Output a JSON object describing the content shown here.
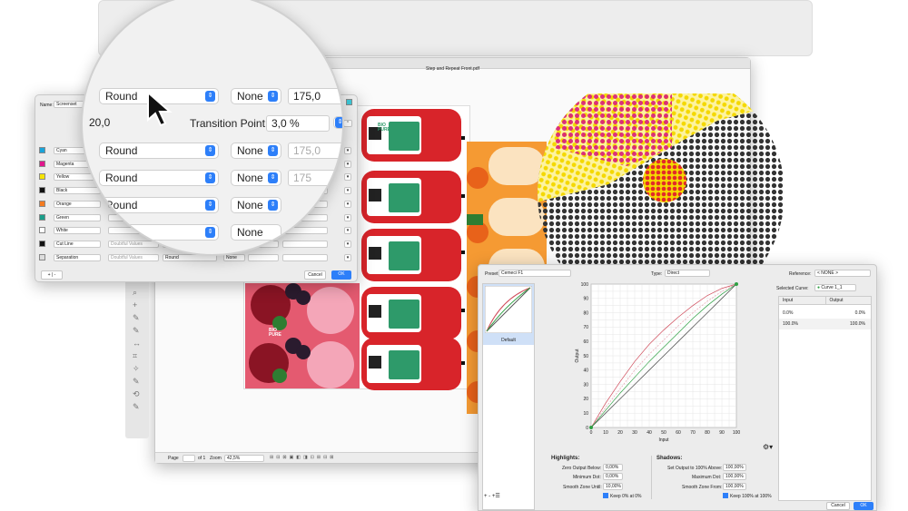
{
  "doc_window": {
    "title": "Step and Repeat Front.pdf"
  },
  "ink_dialog": {
    "name_label": "Name:",
    "name_value": "Screenset",
    "rows": [
      {
        "swatch": "#1aa3d9",
        "name": "Cyan",
        "shape": "Round",
        "dot": "None"
      },
      {
        "swatch": "#e0168c",
        "name": "Magenta",
        "shape": "Round",
        "dot": "None"
      },
      {
        "swatch": "#f6e400",
        "name": "Yellow",
        "shape": "Round",
        "dot": "None"
      },
      {
        "swatch": "#111111",
        "name": "Black",
        "shape": "Round",
        "dot": "None"
      },
      {
        "swatch": "#f47b20",
        "name": "Orange",
        "shape": "Round",
        "dot": "None"
      },
      {
        "swatch": "#1a9e8a",
        "name": "Green",
        "shape": "Round",
        "dot": "None"
      },
      {
        "swatch": "#ffffff",
        "name": "White",
        "shape": "Round",
        "dot": "None"
      },
      {
        "swatch": "#111111",
        "name": "Cut Line",
        "placeholder": "Doubtful Values",
        "shape": "Round",
        "dot": "None"
      },
      {
        "swatch": "#dddddd",
        "name": "Separation",
        "placeholder": "Doubtful Values",
        "shape": "Round",
        "dot": "None"
      }
    ],
    "cancel": "Cancel",
    "ok": "OK",
    "add_remove": "+ | -"
  },
  "magnifier": {
    "row1": {
      "shape": "Round",
      "dot": "None",
      "value": "175,0"
    },
    "row2": {
      "left_value": "20,0",
      "transition_label": "Transition Point:",
      "transition_value": "3,0 %"
    },
    "row3": {
      "shape": "Round",
      "dot": "None",
      "value": "175,0"
    },
    "row4": {
      "shape": "Round",
      "dot": "None",
      "value": "175"
    },
    "row5": {
      "shape": "Round",
      "dot": "None"
    },
    "row6": {
      "dot": "None"
    }
  },
  "status_bar": {
    "page_label": "Page",
    "page_of": "of 1",
    "zoom_label": "Zoom",
    "zoom_value": "42,5%"
  },
  "labels": {
    "brand": "BIO PURE"
  },
  "curve_dialog": {
    "preset_label": "Preset:",
    "preset_value": "Cemeci F1",
    "type_label": "Type:",
    "type_value": "Direct",
    "reference_label": "Reference:",
    "reference_value": "< NONE >",
    "selected_curve_label": "Selected Curve:",
    "selected_curve_value": "Curve 1_1",
    "thumb_label": "Default",
    "y_axis_label": "Output",
    "x_axis_label": "Input",
    "ticks": [
      "0",
      "10",
      "20",
      "30",
      "40",
      "50",
      "60",
      "70",
      "80",
      "90",
      "100"
    ],
    "table_headers": [
      "Input",
      "Output"
    ],
    "table_rows": [
      [
        "0.0%",
        "0.0%"
      ],
      [
        "100.0%",
        "100.0%"
      ]
    ],
    "highlights": {
      "title": "Highlights:",
      "zero_output_label": "Zero Output Below:",
      "zero_output_value": "0,00%",
      "min_dot_label": "Minimum Dot:",
      "min_dot_value": "0,00%",
      "smooth_label": "Smooth Zone Until:",
      "smooth_value": "10,00%",
      "keep_label": "Keep 0% at 0%"
    },
    "shadows": {
      "title": "Shadows:",
      "set_output_label": "Set Output to 100% Above:",
      "set_output_value": "100,00%",
      "max_dot_label": "Maximum Dot:",
      "max_dot_value": "100,00%",
      "smooth_label": "Smooth Zone From:",
      "smooth_value": "100,00%",
      "keep_label": "Keep 100% at 100%"
    },
    "bottom_tools": "+  -  +☰",
    "cancel": "Cancel",
    "ok": "OK"
  },
  "chart_data": {
    "type": "line",
    "xlabel": "Input",
    "ylabel": "Output",
    "xlim": [
      0,
      100
    ],
    "ylim": [
      0,
      100
    ],
    "grid": true,
    "x": [
      0,
      10,
      20,
      30,
      40,
      50,
      60,
      70,
      80,
      90,
      100
    ],
    "series": [
      {
        "color": "#555555",
        "values": [
          0,
          10,
          20,
          30,
          40,
          50,
          60,
          70,
          80,
          90,
          100
        ]
      },
      {
        "color": "#d04a5a",
        "values": [
          0,
          17,
          32,
          46,
          58,
          68,
          77,
          85,
          92,
          97,
          100
        ]
      },
      {
        "color": "#e8a0b0",
        "values": [
          0,
          14,
          27,
          40,
          51,
          61,
          71,
          80,
          88,
          95,
          100
        ]
      },
      {
        "color": "#2ea043",
        "values": [
          0,
          12,
          24,
          35,
          46,
          56,
          66,
          76,
          85,
          93,
          100
        ]
      }
    ]
  }
}
